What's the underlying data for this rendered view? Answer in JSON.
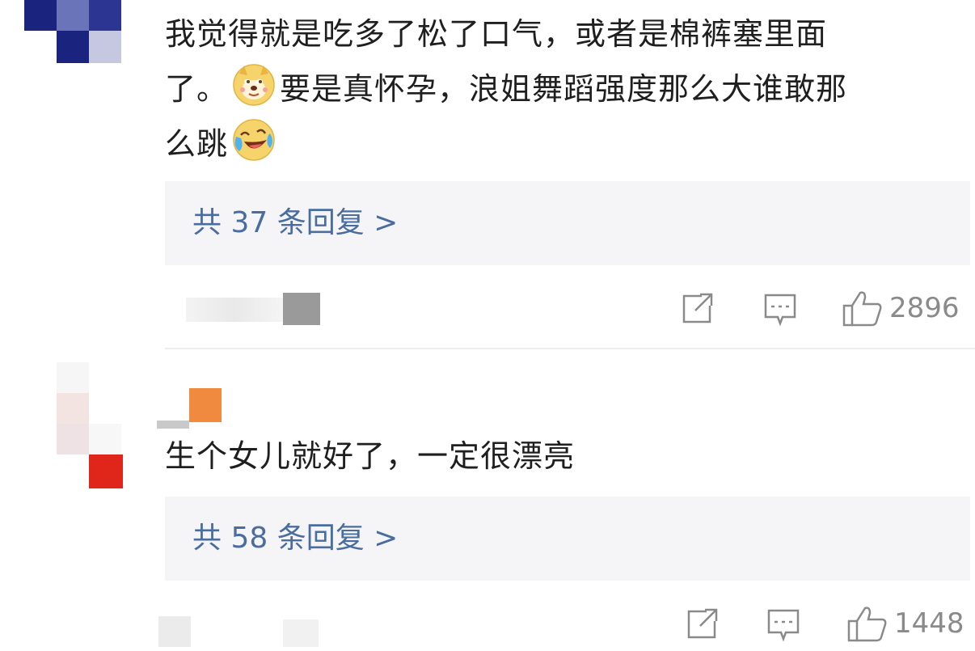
{
  "comments": [
    {
      "text_line1": "我觉得就是吃多了松了口气，或者是棉裤塞里面",
      "text_line2_a": "了。",
      "emoji_1": "doge-emoji",
      "text_line2_b": "要是真怀孕，浪姐舞蹈强度那么大谁敢那",
      "text_line3": "么跳",
      "emoji_2": "laughing-tears-emoji",
      "reply_label": "共 37 条回复 >",
      "likes": "2896"
    },
    {
      "text_line1": "生个女儿就好了，一定很漂亮",
      "reply_label": "共 58 条回复 >",
      "likes": "1448"
    }
  ],
  "colors": {
    "reply_link": "#4a6d9f",
    "reply_bg": "#f5f5f7",
    "icon_gray": "#8a8a8a",
    "avatar_blue": "#1a237e",
    "avatar_red": "#e0261b",
    "avatar_orange": "#f08a3e"
  },
  "icons": [
    "share-icon",
    "comment-icon",
    "like-icon"
  ]
}
